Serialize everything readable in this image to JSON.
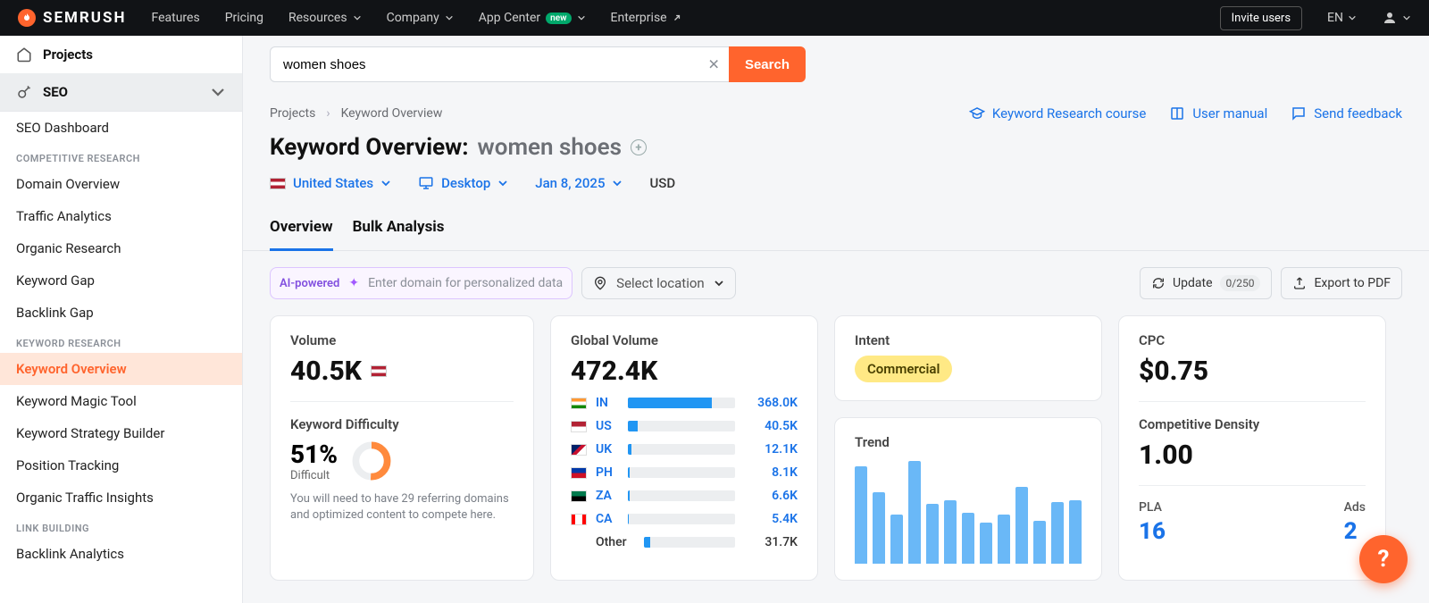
{
  "brand": "SEMRUSH",
  "topnav": {
    "features": "Features",
    "pricing": "Pricing",
    "resources": "Resources",
    "company": "Company",
    "appcenter": "App Center",
    "appcenter_badge": "new",
    "enterprise": "Enterprise",
    "invite": "Invite users",
    "lang": "EN"
  },
  "sidebar": {
    "projects": "Projects",
    "seo": "SEO",
    "dashboard": "SEO Dashboard",
    "sections": {
      "competitive": "COMPETITIVE RESEARCH",
      "keyword": "KEYWORD RESEARCH",
      "link": "LINK BUILDING"
    },
    "items": {
      "domain_overview": "Domain Overview",
      "traffic_analytics": "Traffic Analytics",
      "organic_research": "Organic Research",
      "keyword_gap": "Keyword Gap",
      "backlink_gap": "Backlink Gap",
      "keyword_overview": "Keyword Overview",
      "keyword_magic": "Keyword Magic Tool",
      "keyword_strategy": "Keyword Strategy Builder",
      "position_tracking": "Position Tracking",
      "organic_traffic": "Organic Traffic Insights",
      "backlink_analytics": "Backlink Analytics"
    }
  },
  "search": {
    "value": "women shoes",
    "button": "Search"
  },
  "crumbs": {
    "projects": "Projects",
    "current": "Keyword Overview"
  },
  "links": {
    "course": "Keyword Research course",
    "manual": "User manual",
    "feedback": "Send feedback"
  },
  "title": {
    "prefix": "Keyword Overview:",
    "keyword": "women shoes"
  },
  "filters": {
    "country": "United States",
    "device": "Desktop",
    "date": "Jan 8, 2025",
    "currency": "USD"
  },
  "tabs": {
    "overview": "Overview",
    "bulk": "Bulk Analysis"
  },
  "toolbar": {
    "ai": "AI-powered",
    "ai_placeholder": "Enter domain for personalized data",
    "location_placeholder": "Select location",
    "update": "Update",
    "update_count": "0/250",
    "export": "Export to PDF"
  },
  "card_volume": {
    "title": "Volume",
    "value": "40.5K"
  },
  "card_kd": {
    "title": "Keyword Difficulty",
    "pct": "51%",
    "label": "Difficult",
    "note": "You will need to have 29 referring domains and optimized content to compete here."
  },
  "card_global": {
    "title": "Global Volume",
    "value": "472.4K",
    "rows": [
      {
        "cc": "IN",
        "val": "368.0K",
        "pct": 78
      },
      {
        "cc": "US",
        "val": "40.5K",
        "pct": 9
      },
      {
        "cc": "UK",
        "val": "12.1K",
        "pct": 3
      },
      {
        "cc": "PH",
        "val": "8.1K",
        "pct": 2
      },
      {
        "cc": "ZA",
        "val": "6.6K",
        "pct": 2
      },
      {
        "cc": "CA",
        "val": "5.4K",
        "pct": 1
      }
    ],
    "other_label": "Other",
    "other_val": "31.7K",
    "other_pct": 7
  },
  "card_intent": {
    "title": "Intent",
    "value": "Commercial"
  },
  "card_trend": {
    "title": "Trend"
  },
  "card_cpc": {
    "title": "CPC",
    "value": "$0.75"
  },
  "card_cd": {
    "title": "Competitive Density",
    "value": "1.00"
  },
  "card_pla": {
    "title": "PLA",
    "value": "16"
  },
  "card_ads": {
    "title": "Ads",
    "value": "2"
  },
  "chart_data": {
    "type": "bar",
    "title": "Trend",
    "values": [
      95,
      70,
      48,
      100,
      58,
      62,
      50,
      40,
      48,
      75,
      42,
      60,
      62
    ]
  },
  "flag_colors": {
    "IN": "linear-gradient(#ff9933 33%, #fff 33% 66%, #138808 66%)",
    "US": "linear-gradient(#b22234, #b22234 50%, #fff 50%)",
    "UK": "linear-gradient(135deg,#012169 40%,#c8102e 40% 60%,#fff 60%)",
    "PH": "linear-gradient(#0038a8 50%, #ce1126 50%)",
    "ZA": "linear-gradient(#007a4d, #007a4d 50%, #000 50%)",
    "CA": "linear-gradient(90deg,#ff0000 25%,#fff 25% 75%,#ff0000 75%)"
  }
}
